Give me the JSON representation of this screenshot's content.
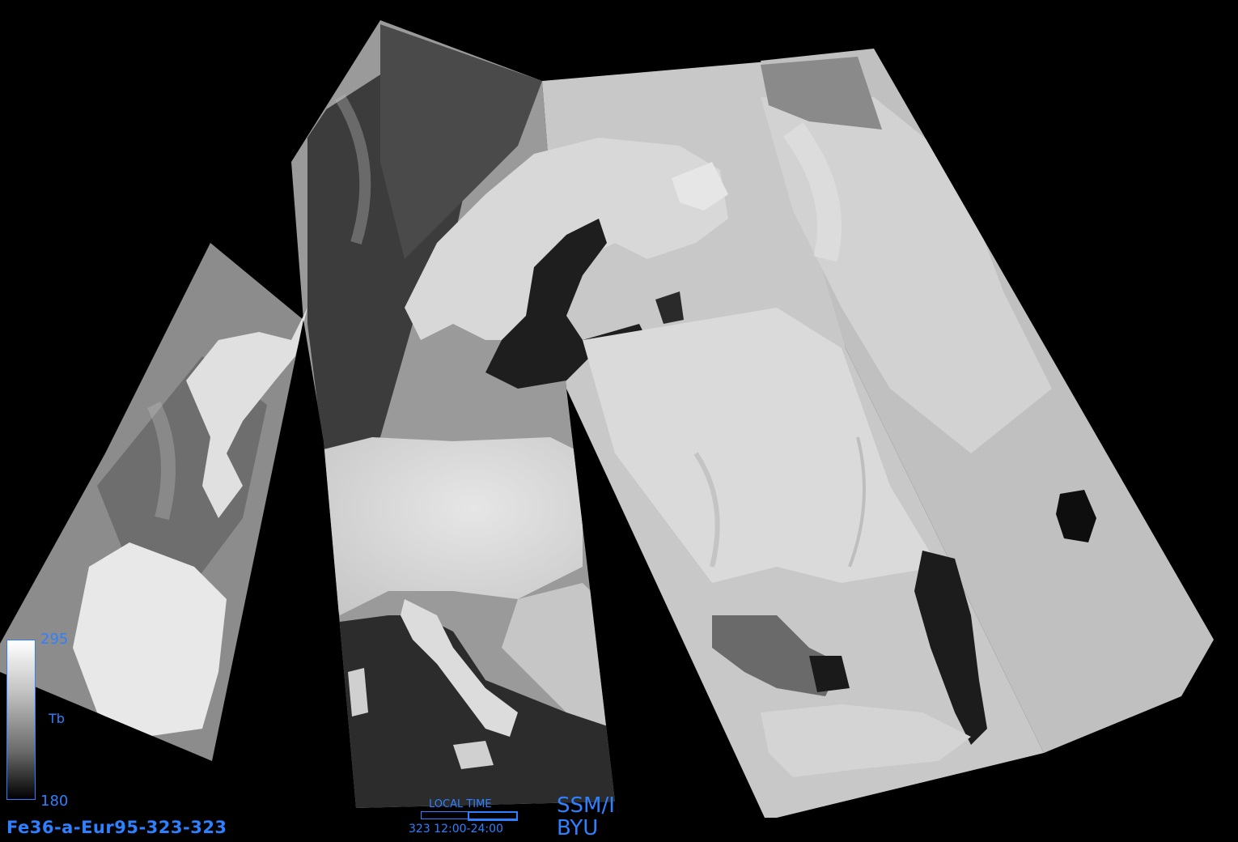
{
  "product": {
    "file_id": "Fe36-a-Eur95-323-323",
    "sensor": "SSM/I",
    "organization": "BYU"
  },
  "colorbar": {
    "max_label": "295",
    "min_label": "180",
    "variable_label": "Tb",
    "range": [
      180,
      295
    ],
    "colors": [
      "#000000",
      "#ffffff"
    ]
  },
  "local_time": {
    "label": "LOCAL TIME",
    "value": "323 12:00-24:00",
    "fill_fraction": 0.5
  },
  "colors": {
    "annotation": "#2f80ff",
    "background": "#000000"
  }
}
